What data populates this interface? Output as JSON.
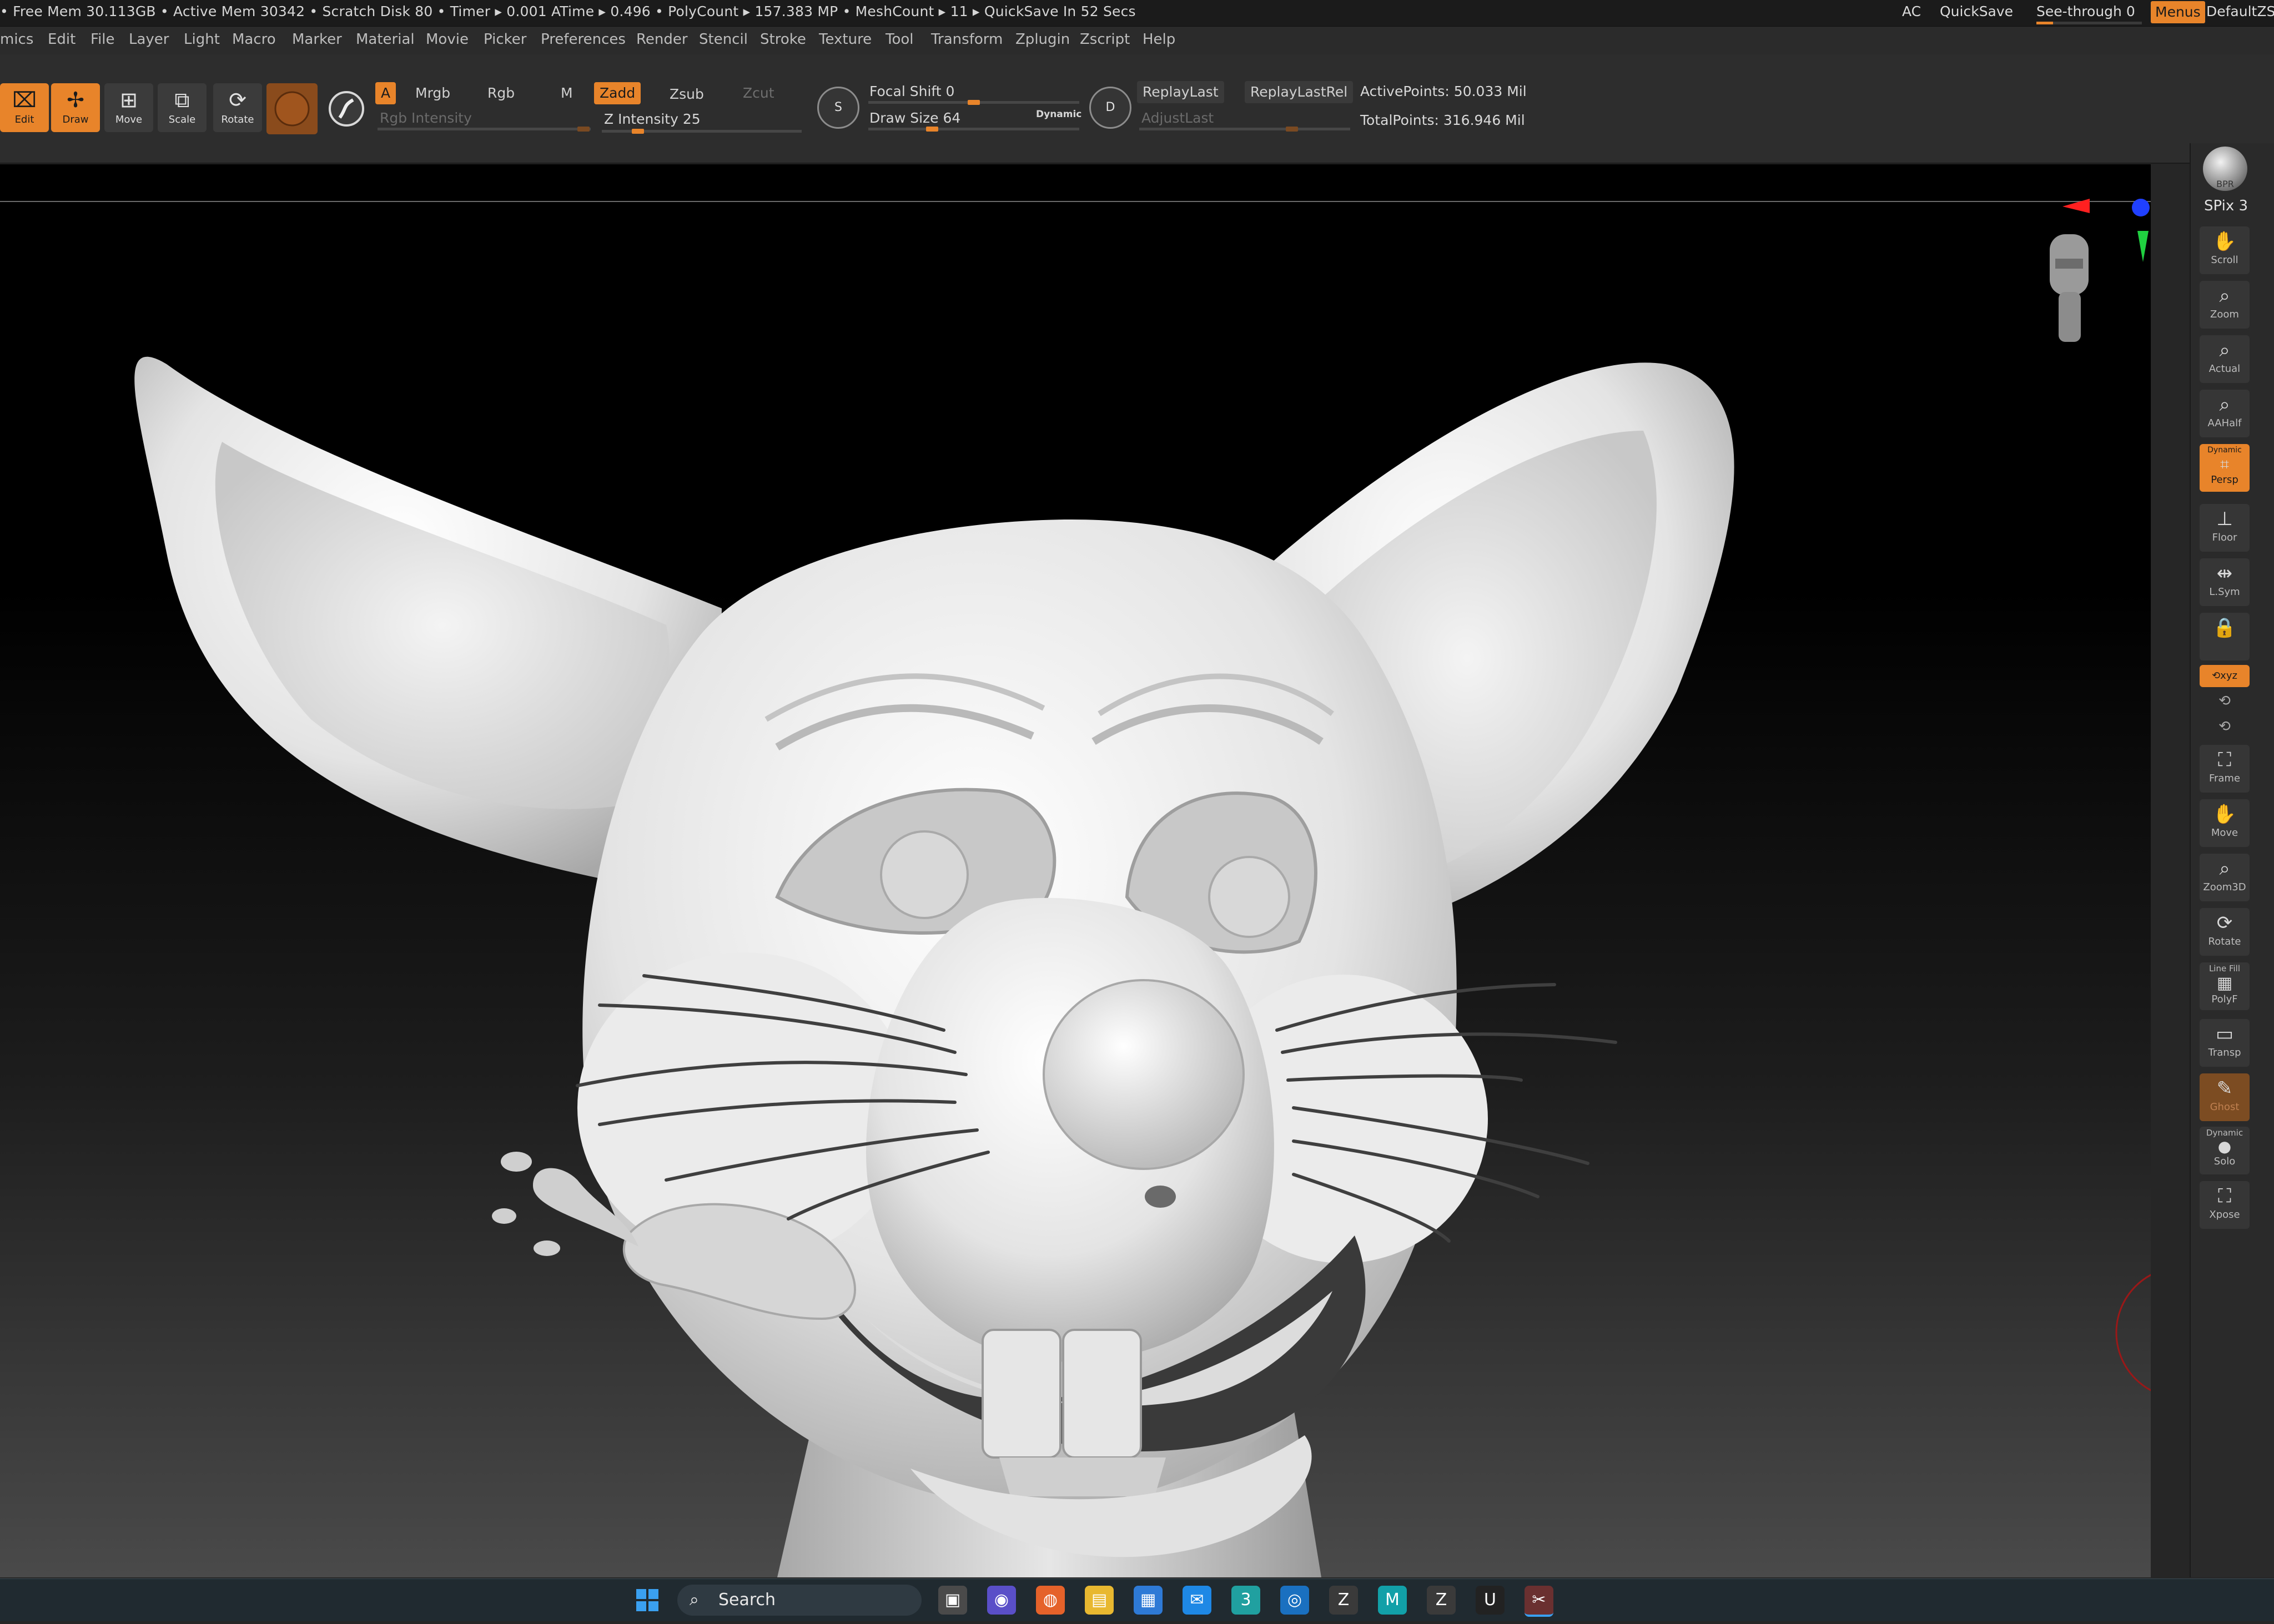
{
  "status_bar": {
    "text": "• Free Mem 30.113GB • Active Mem 30342 • Scratch Disk 80 •  Timer ▸ 0.001 ATime ▸ 0.496 • PolyCount ▸ 157.383 MP  • MeshCount ▸ 11   ▸ QuickSave In 52 Secs",
    "ac": "AC",
    "quicksave": "QuickSave",
    "see_through": "See-through  0",
    "see_through_value": 0.05,
    "menus": "Menus",
    "default_zscript": "DefaultZSc"
  },
  "menu_bar": {
    "items": [
      "mics",
      "Edit",
      "File",
      "Layer",
      "Light",
      "Macro",
      "Marker",
      "Material",
      "Movie",
      "Picker",
      "Preferences",
      "Render",
      "Stencil",
      "Stroke",
      "Texture",
      "Tool",
      "Transform",
      "Zplugin",
      "Zscript",
      "Help"
    ]
  },
  "shelf": {
    "edit": "Edit",
    "draw": "Draw",
    "move": "Move",
    "scale": "Scale",
    "rotate": "Rotate",
    "a_toggle": "A",
    "mrgb": "Mrgb",
    "rgb": "Rgb",
    "m": "M",
    "zadd": "Zadd",
    "zsub": "Zsub",
    "zcut": "Zcut",
    "rgb_intensity": "Rgb Intensity",
    "z_intensity": "Z Intensity 25",
    "z_intensity_value": 25,
    "focal_shift": "Focal Shift 0",
    "focal_shift_value": 0,
    "draw_size": "Draw Size 64",
    "draw_size_value": 64,
    "dynamic": "Dynamic",
    "lazy_s": "S",
    "lazy_d": "D",
    "replay_last": "ReplayLast",
    "replay_last_rel": "ReplayLastRel",
    "adjust_last": "AdjustLast",
    "active_points": "ActivePoints: 50.033 Mil",
    "total_points": "TotalPoints: 316.946 Mil"
  },
  "right_shelf": {
    "bpr": "BPR",
    "spix": "SPix 3",
    "scroll": "Scroll",
    "zoom": "Zoom",
    "actual": "Actual",
    "aahalf": "AAHalf",
    "dynamic": "Dynamic",
    "persp": "Persp",
    "floor": "Floor",
    "lsym": "L.Sym",
    "xyz": "⟲xyz",
    "frame": "Frame",
    "move": "Move",
    "zoom3d": "Zoom3D",
    "rotate": "Rotate",
    "line_fill": "Line Fill",
    "polyf": "PolyF",
    "transp": "Transp",
    "ghost": "Ghost",
    "dynamic2": "Dynamic",
    "solo": "Solo",
    "xpose": "Xpose"
  },
  "taskbar": {
    "search": "Search"
  },
  "colors": {
    "accent": "#e8842a",
    "panel": "#2d2d2d",
    "taskbar": "#202a30"
  }
}
